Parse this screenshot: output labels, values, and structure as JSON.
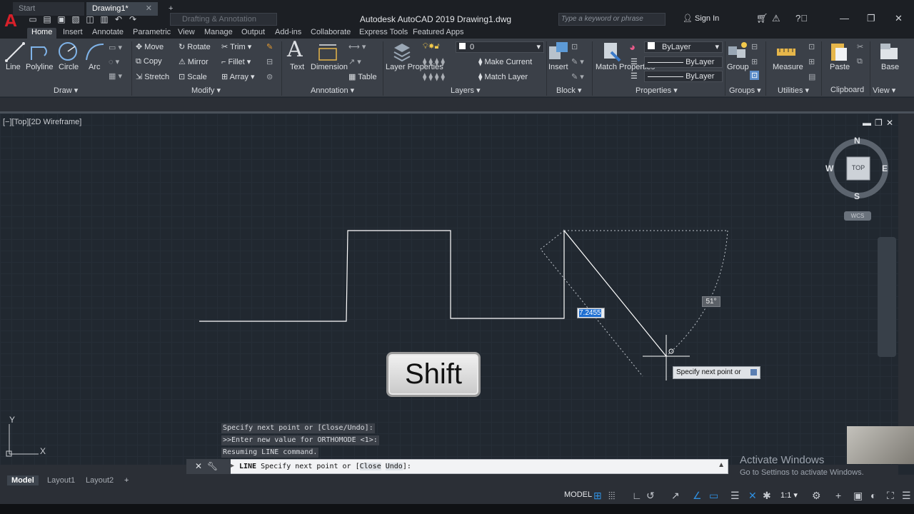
{
  "titlebar": {
    "logo": "A",
    "workspace": "Drafting & Annotation",
    "title": "Autodesk AutoCAD 2019    Drawing1.dwg",
    "search_placeholder": "Type a keyword or phrase",
    "signin": "Sign In",
    "qat_icons": [
      "new-icon",
      "open-icon",
      "save-icon",
      "saveas-icon",
      "web-icon",
      "plot-icon",
      "undo-icon",
      "redo-icon"
    ]
  },
  "ribbon_tabs": [
    "Home",
    "Insert",
    "Annotate",
    "Parametric",
    "View",
    "Manage",
    "Output",
    "Add-ins",
    "Collaborate",
    "Express Tools",
    "Featured Apps"
  ],
  "draw": {
    "line": "Line",
    "polyline": "Polyline",
    "circle": "Circle",
    "arc": "Arc",
    "title": "Draw"
  },
  "modify": {
    "move": "Move",
    "rotate": "Rotate",
    "trim": "Trim",
    "copy": "Copy",
    "mirror": "Mirror",
    "fillet": "Fillet",
    "stretch": "Stretch",
    "scale": "Scale",
    "array": "Array",
    "title": "Modify"
  },
  "annotation": {
    "text": "Text",
    "dimension": "Dimension",
    "table": "Table",
    "title": "Annotation"
  },
  "layers": {
    "properties": "Layer Properties",
    "current_layer": "0",
    "make_current": "Make Current",
    "match_layer": "Match Layer",
    "title": "Layers"
  },
  "block": {
    "insert": "Insert",
    "title": "Block"
  },
  "properties": {
    "match": "Match Properties",
    "color": "ByLayer",
    "linetype": "ByLayer",
    "lineweight": "ByLayer",
    "title": "Properties"
  },
  "groups": {
    "group": "Group",
    "title": "Groups"
  },
  "utilities": {
    "measure": "Measure",
    "title": "Utilities"
  },
  "clipboard": {
    "paste": "Paste",
    "title": "Clipboard"
  },
  "view": {
    "base": "Base",
    "title": "View"
  },
  "doc_tabs": [
    "Start",
    "Drawing1*"
  ],
  "viewport": {
    "label": "[−][Top][2D Wireframe]"
  },
  "viewcube": {
    "n": "N",
    "s": "S",
    "e": "E",
    "w": "W",
    "top": "TOP",
    "wcs": "WCS"
  },
  "ucs": {
    "x": "X",
    "y": "Y"
  },
  "dynamic": {
    "length": "7.2455",
    "angle": "51°",
    "prompt": "Specify next point or"
  },
  "overlay_key": "Shift",
  "command_history": [
    "Specify next point or [Close/Undo]:",
    ">>Enter new value for ORTHOMODE <1>:",
    "Resuming LINE command."
  ],
  "command_line": {
    "command": "LINE",
    "prompt": "Specify next point or [",
    "opt1": "Close",
    "opt2": "Undo",
    "suffix": "]:"
  },
  "layout_tabs": [
    "Model",
    "Layout1",
    "Layout2"
  ],
  "status": {
    "model": "MODEL",
    "scale": "1:1"
  },
  "watermark": {
    "line1": "Activate Windows",
    "line2": "Go to Settings to activate Windows."
  },
  "colors": {
    "accent": "#2f8fe0",
    "canvas": "#212830",
    "ribbon": "#3b4048"
  }
}
